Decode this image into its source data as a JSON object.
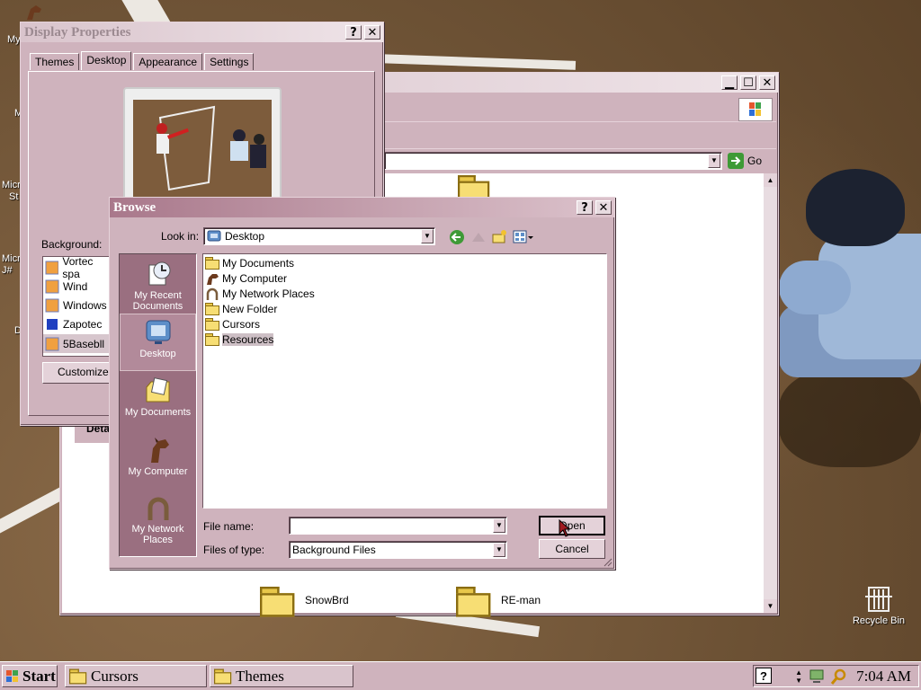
{
  "desktop": {
    "icon_labels_left": [
      "My",
      "M",
      "Micr",
      "St",
      "Micr",
      "J#",
      "D"
    ],
    "recycle_bin_label": "Recycle Bin"
  },
  "explorer": {
    "go_label": "Go",
    "details_label": "Deta",
    "folders": [
      "SnowBrd",
      "RE-man"
    ]
  },
  "display_properties": {
    "title": "Display Properties",
    "tabs": [
      "Themes",
      "Desktop",
      "Appearance",
      "Settings"
    ],
    "selected_tab": "Desktop",
    "background_label": "Background:",
    "background_items": [
      "Vortec spa",
      "Wind",
      "Windows",
      "Zapotec",
      "5Basebll"
    ],
    "selected_background": "5Basebll",
    "customize_button": "Customize D"
  },
  "browse": {
    "title": "Browse",
    "look_in_label": "Look in:",
    "look_in_value": "Desktop",
    "places": [
      {
        "label": "My Recent Documents",
        "icon": "recent-documents-icon"
      },
      {
        "label": "Desktop",
        "icon": "desktop-icon"
      },
      {
        "label": "My Documents",
        "icon": "my-documents-icon"
      },
      {
        "label": "My Computer",
        "icon": "horse-icon"
      },
      {
        "label": "My Network Places",
        "icon": "horseshoe-icon"
      }
    ],
    "selected_place": "Desktop",
    "files": [
      {
        "name": "My Documents",
        "icon": "folder-icon"
      },
      {
        "name": "My Computer",
        "icon": "horse-icon"
      },
      {
        "name": "My Network Places",
        "icon": "horseshoe-icon"
      },
      {
        "name": "New Folder",
        "icon": "folder-icon"
      },
      {
        "name": "Cursors",
        "icon": "folder-icon"
      },
      {
        "name": "Resources",
        "icon": "folder-shortcut-icon"
      }
    ],
    "selected_file": "Resources",
    "file_name_label": "File name:",
    "file_name_value": "",
    "files_of_type_label": "Files of type:",
    "files_of_type_value": "Background Files",
    "open_button": "Open",
    "cancel_button": "Cancel"
  },
  "taskbar": {
    "start_label": "Start",
    "tasks": [
      "Cursors",
      "Themes"
    ],
    "clock": "7:04 AM"
  },
  "colors": {
    "window_face": "#cfb3bd",
    "places_bar": "#9a6f80",
    "active_title": "#a9788b"
  }
}
